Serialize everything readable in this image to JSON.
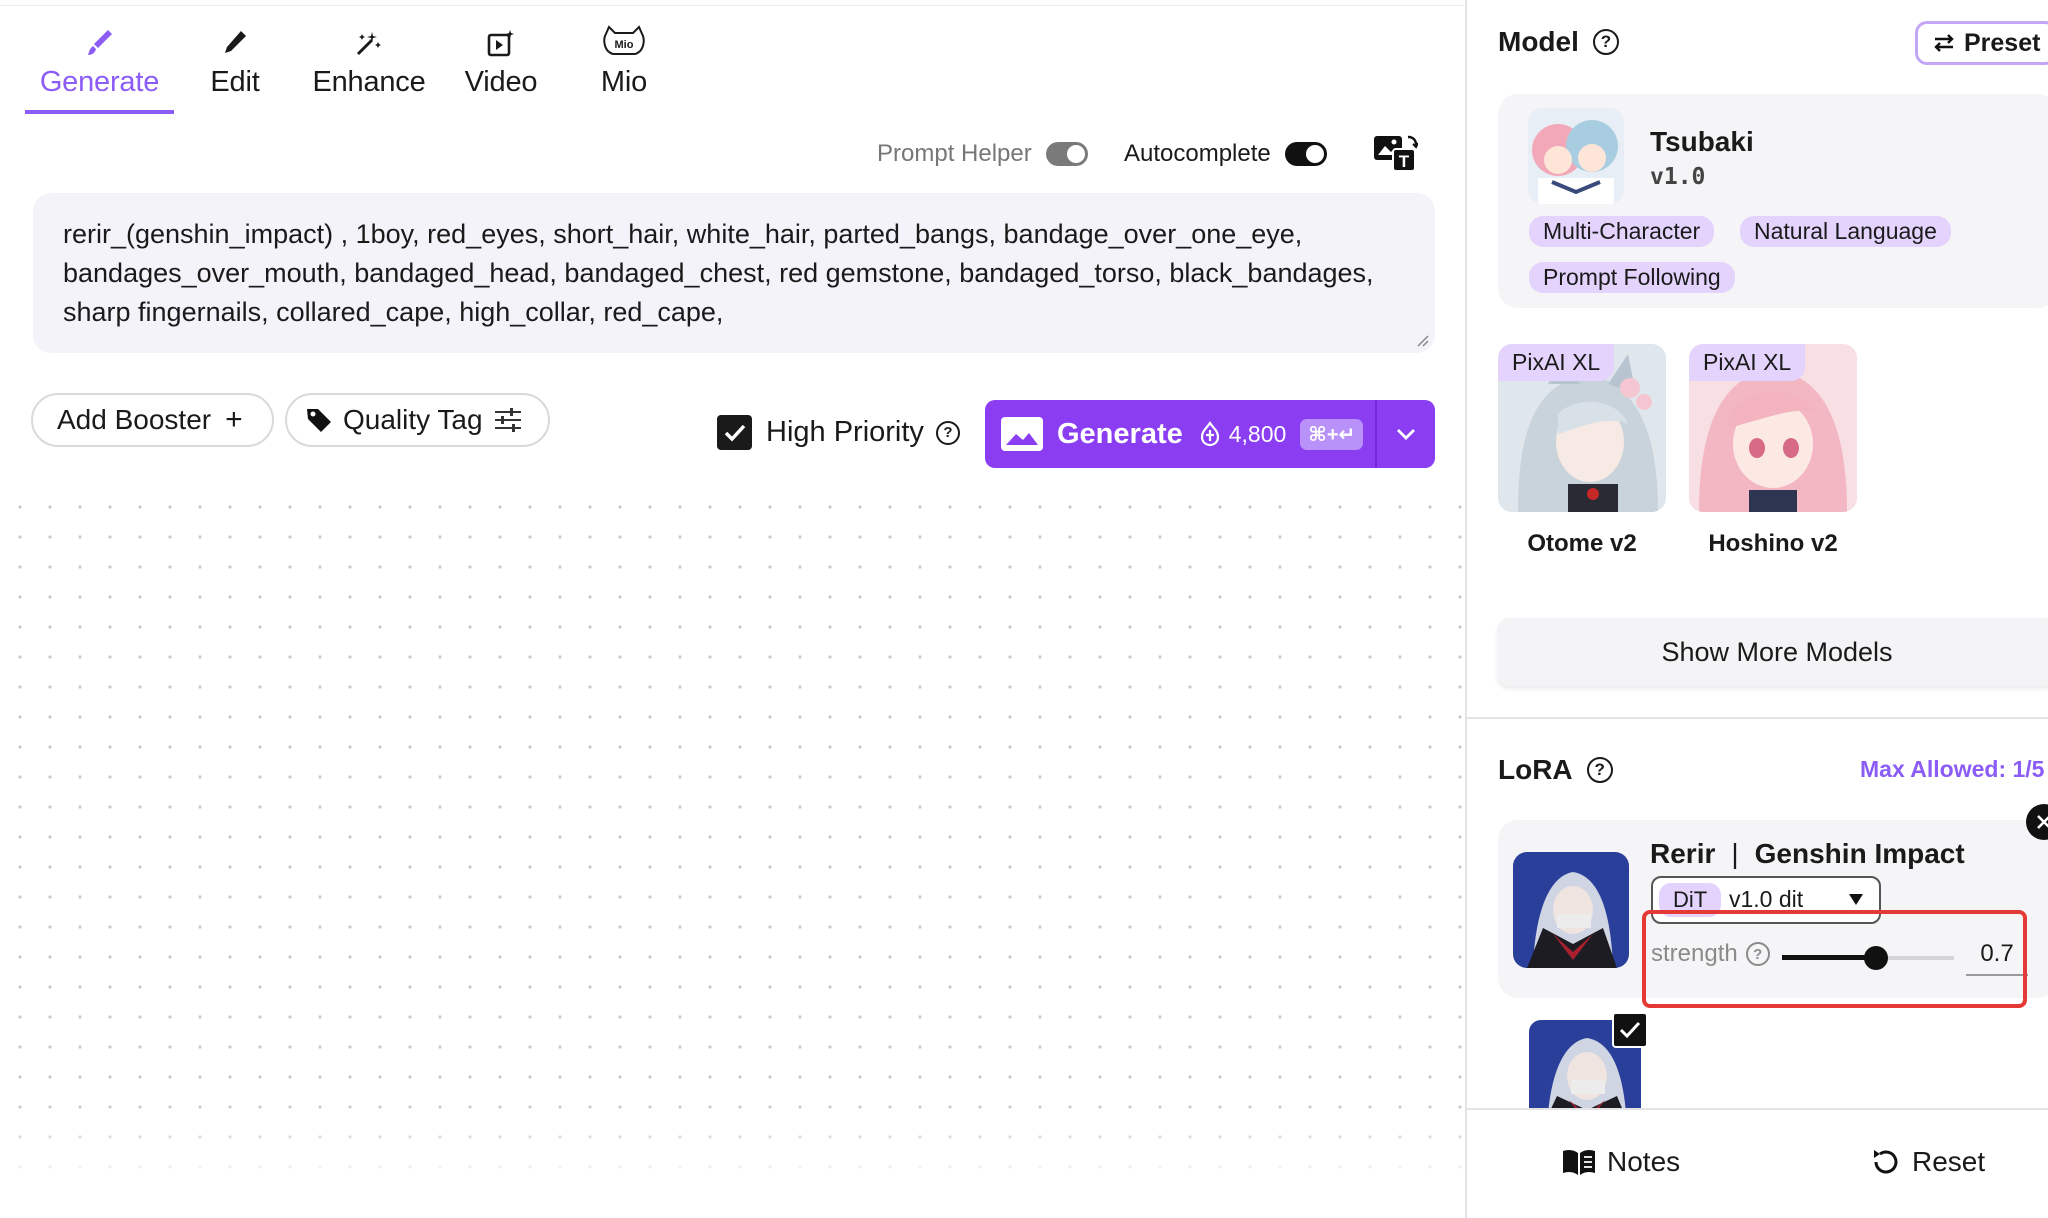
{
  "tabs": [
    {
      "label": "Generate",
      "icon": "brush-icon",
      "active": true
    },
    {
      "label": "Edit",
      "icon": "pencil-icon"
    },
    {
      "label": "Enhance",
      "icon": "magic-wand-icon"
    },
    {
      "label": "Video",
      "icon": "video-sparkle-icon"
    },
    {
      "label": "Mio",
      "icon": "mio-cat-icon"
    }
  ],
  "toggles": {
    "prompt_helper": {
      "label": "Prompt Helper",
      "on": true,
      "disabled": true
    },
    "autocomplete": {
      "label": "Autocomplete",
      "on": true
    }
  },
  "prompt": {
    "text": "rerir_(genshin_impact) , 1boy, red_eyes, short_hair, white_hair, parted_bangs, bandage_over_one_eye, bandages_over_mouth, bandaged_head, bandaged_chest, red gemstone, bandaged_torso, black_bandages, sharp fingernails, collared_cape, high_collar, red_cape,"
  },
  "actions": {
    "add_booster": "Add Booster",
    "quality_tag": "Quality Tag",
    "high_priority": "High Priority",
    "generate": "Generate",
    "cost": "4,800",
    "shortcut": "⌘+↵"
  },
  "model": {
    "section_title": "Model",
    "preset_label": "Preset",
    "name": "Tsubaki",
    "version": "v1.0",
    "tags": [
      "Multi-Character",
      "Natural Language",
      "Prompt Following"
    ],
    "alternatives": [
      {
        "badge": "PixAI XL",
        "name": "Otome v2"
      },
      {
        "badge": "PixAI XL",
        "name": "Hoshino v2"
      }
    ],
    "show_more": "Show More Models"
  },
  "lora": {
    "section_title": "LoRA",
    "max_allowed": "Max Allowed: 1/5",
    "item": {
      "name": "Rerir",
      "separator": "|",
      "series": "Genshin Impact",
      "type_badge": "DiT",
      "version": "v1.0 dit",
      "strength_label": "strength",
      "strength": 0.7,
      "strength_display": "0.7"
    }
  },
  "footer": {
    "notes": "Notes",
    "reset": "Reset"
  },
  "colors": {
    "accent": "#8b5cf6",
    "generate_bg": "#8b3df2",
    "tag_bg": "#e3d3fd",
    "highlight": "#e53935"
  }
}
